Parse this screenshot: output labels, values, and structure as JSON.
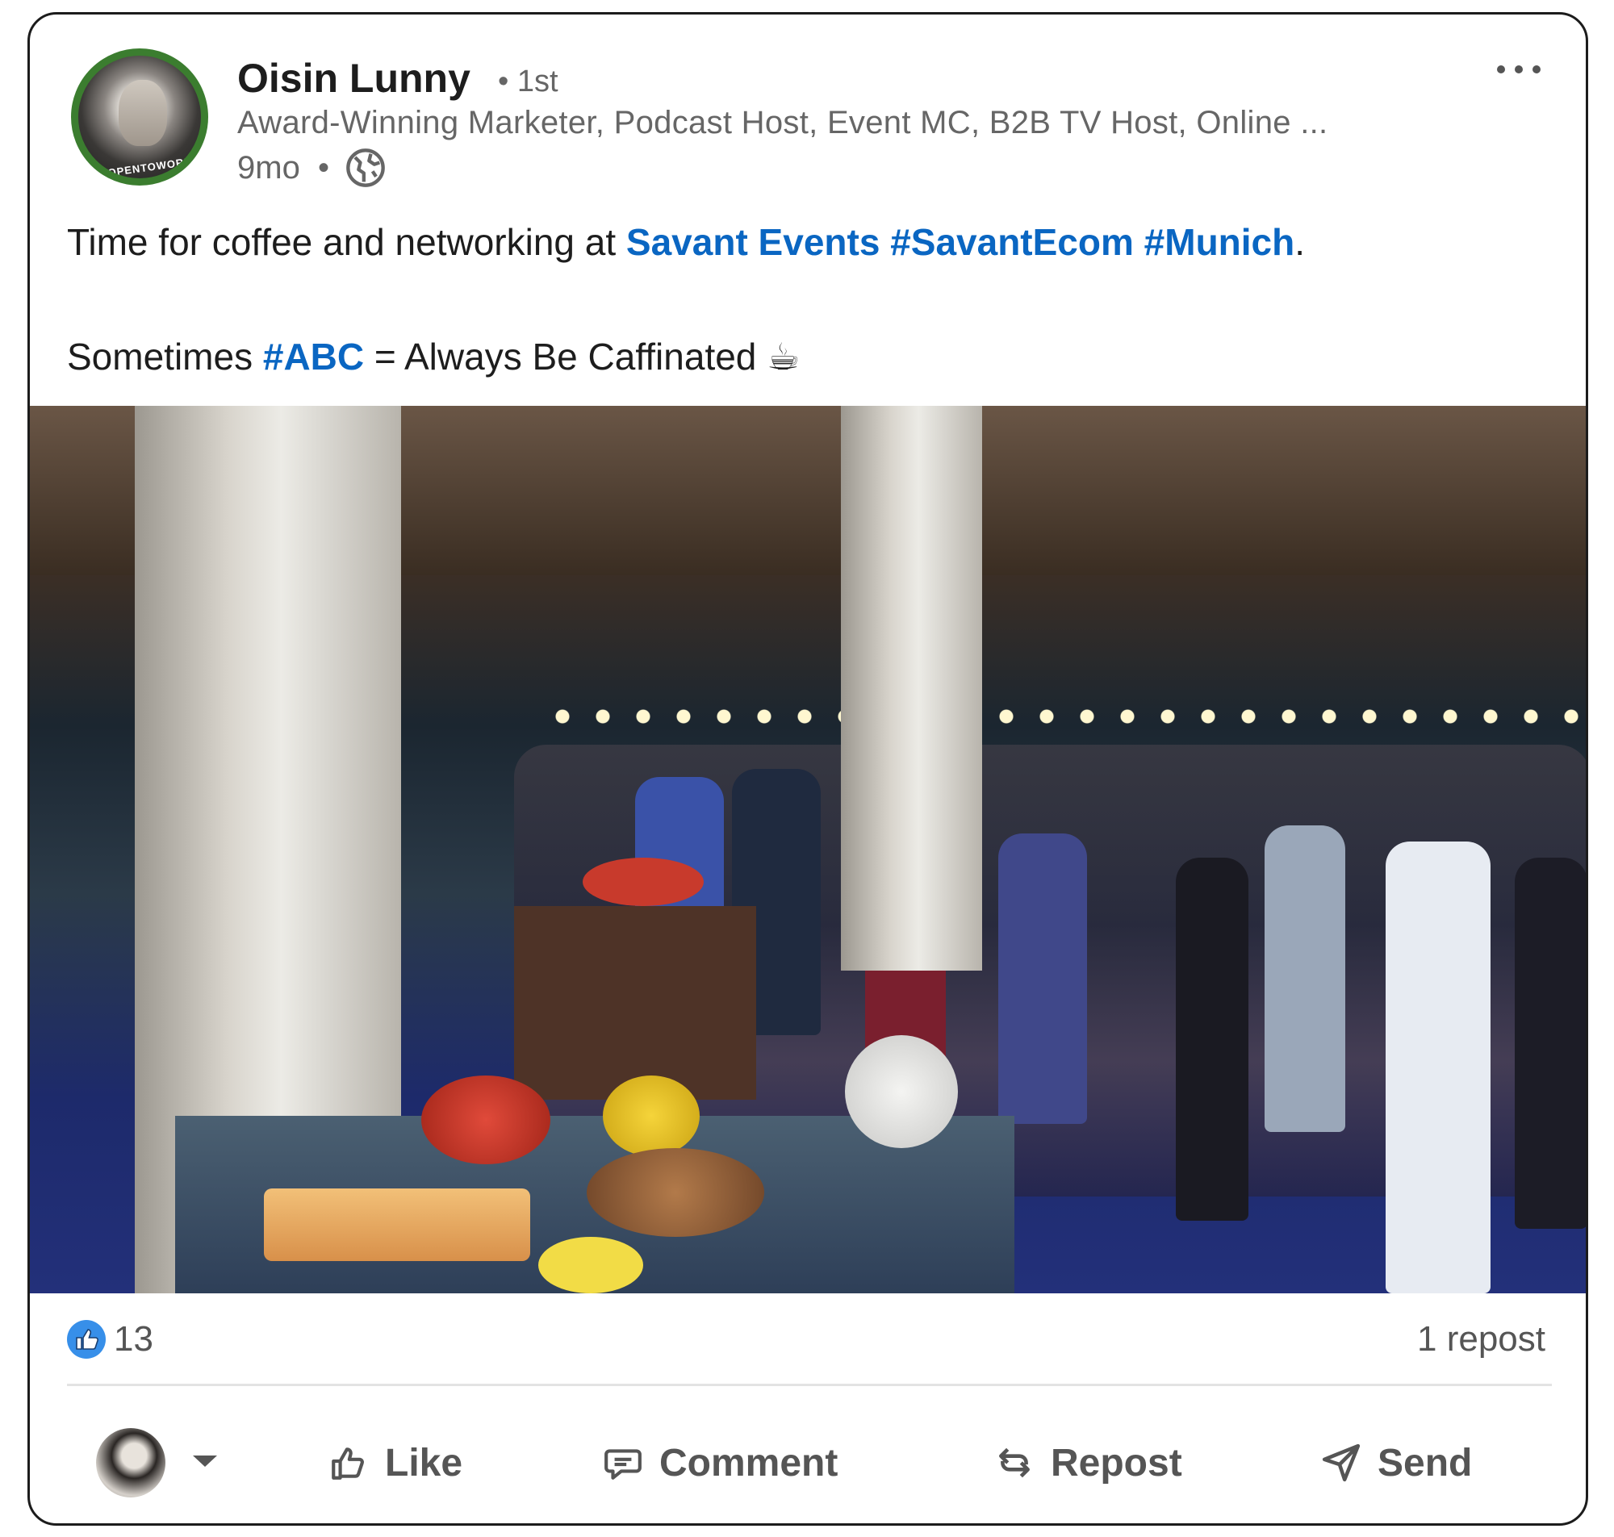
{
  "post": {
    "author": {
      "name": "Oisin Lunny",
      "degree": "• 1st",
      "headline": "Award-Winning Marketer, Podcast Host, Event MC, B2B TV Host, Online ...",
      "timestamp": "9mo",
      "separator": "•",
      "avatar_badge": "#OPENTOWORK"
    },
    "text": {
      "line1_prefix": "Time for coffee and networking at ",
      "line1_link1": "Savant Events",
      "line1_link2": "#SavantEcom",
      "line1_link3": "#Munich",
      "line1_suffix": ".",
      "line2_prefix": "Sometimes ",
      "line2_link": "#ABC",
      "line2_suffix": " = Always Be Caffinated ☕"
    },
    "stats": {
      "reactions": "13",
      "reposts": "1 repost"
    },
    "actions": {
      "like": "Like",
      "comment": "Comment",
      "repost": "Repost",
      "send": "Send"
    }
  },
  "icons": {
    "more": "more-icon",
    "visibility": "globe-icon",
    "reaction": "thumbs-up-icon",
    "like": "thumbs-up-outline-icon",
    "comment": "comment-icon",
    "repost": "repost-icon",
    "send": "send-icon",
    "caret": "chevron-down-icon"
  },
  "colors": {
    "link": "#0a66c2",
    "text": "#1d1d1d",
    "muted": "#666666",
    "like_badge": "#378fe9",
    "opentowork_ring": "#3b7d2f"
  }
}
